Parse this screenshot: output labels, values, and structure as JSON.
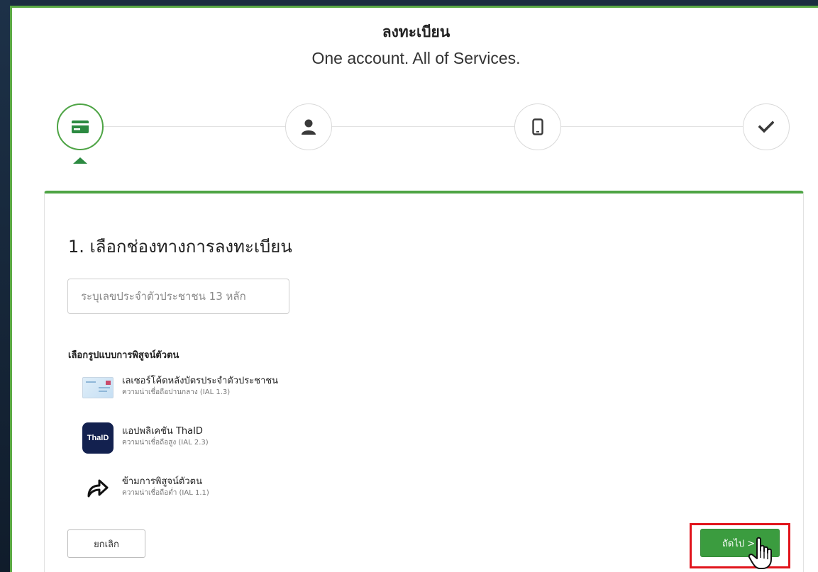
{
  "header": {
    "title": "ลงทะเบียน",
    "subtitle": "One account. All of Services."
  },
  "stepper": {
    "active_index": 0,
    "steps": [
      {
        "icon": "id-card-icon"
      },
      {
        "icon": "user-icon"
      },
      {
        "icon": "mobile-phone-icon"
      },
      {
        "icon": "check-icon"
      }
    ]
  },
  "form": {
    "title": "1. เลือกช่องทางการลงทะเบียน",
    "id_input": {
      "value": "",
      "placeholder": "ระบุเลขประจำตัวประชาชน 13 หลัก"
    },
    "method_heading": "เลือกรูปแบบการพิสูจน์ตัวตน",
    "methods": [
      {
        "label": "เลเซอร์โค้ดหลังบัตรประจำตัวประชาชน",
        "level": "ความน่าเชื่อถือปานกลาง (IAL 1.3)",
        "icon": "id-card-laser-icon"
      },
      {
        "label": "แอปพลิเคชัน ThaID",
        "level": "ความน่าเชื่อถือสูง (IAL 2.3)",
        "icon": "thaid-app-icon",
        "logo_text": "ThaID"
      },
      {
        "label": "ข้ามการพิสูจน์ตัวตน",
        "level": "ความน่าเชื่อถือต่ำ (IAL 1.1)",
        "icon": "skip-arrow-icon"
      }
    ],
    "cancel_label": "ยกเลิก",
    "next_label": "ถัดไป >"
  },
  "colors": {
    "accent_green": "#4ea445",
    "button_green": "#3b9c3f",
    "highlight_red": "#e1141c"
  }
}
